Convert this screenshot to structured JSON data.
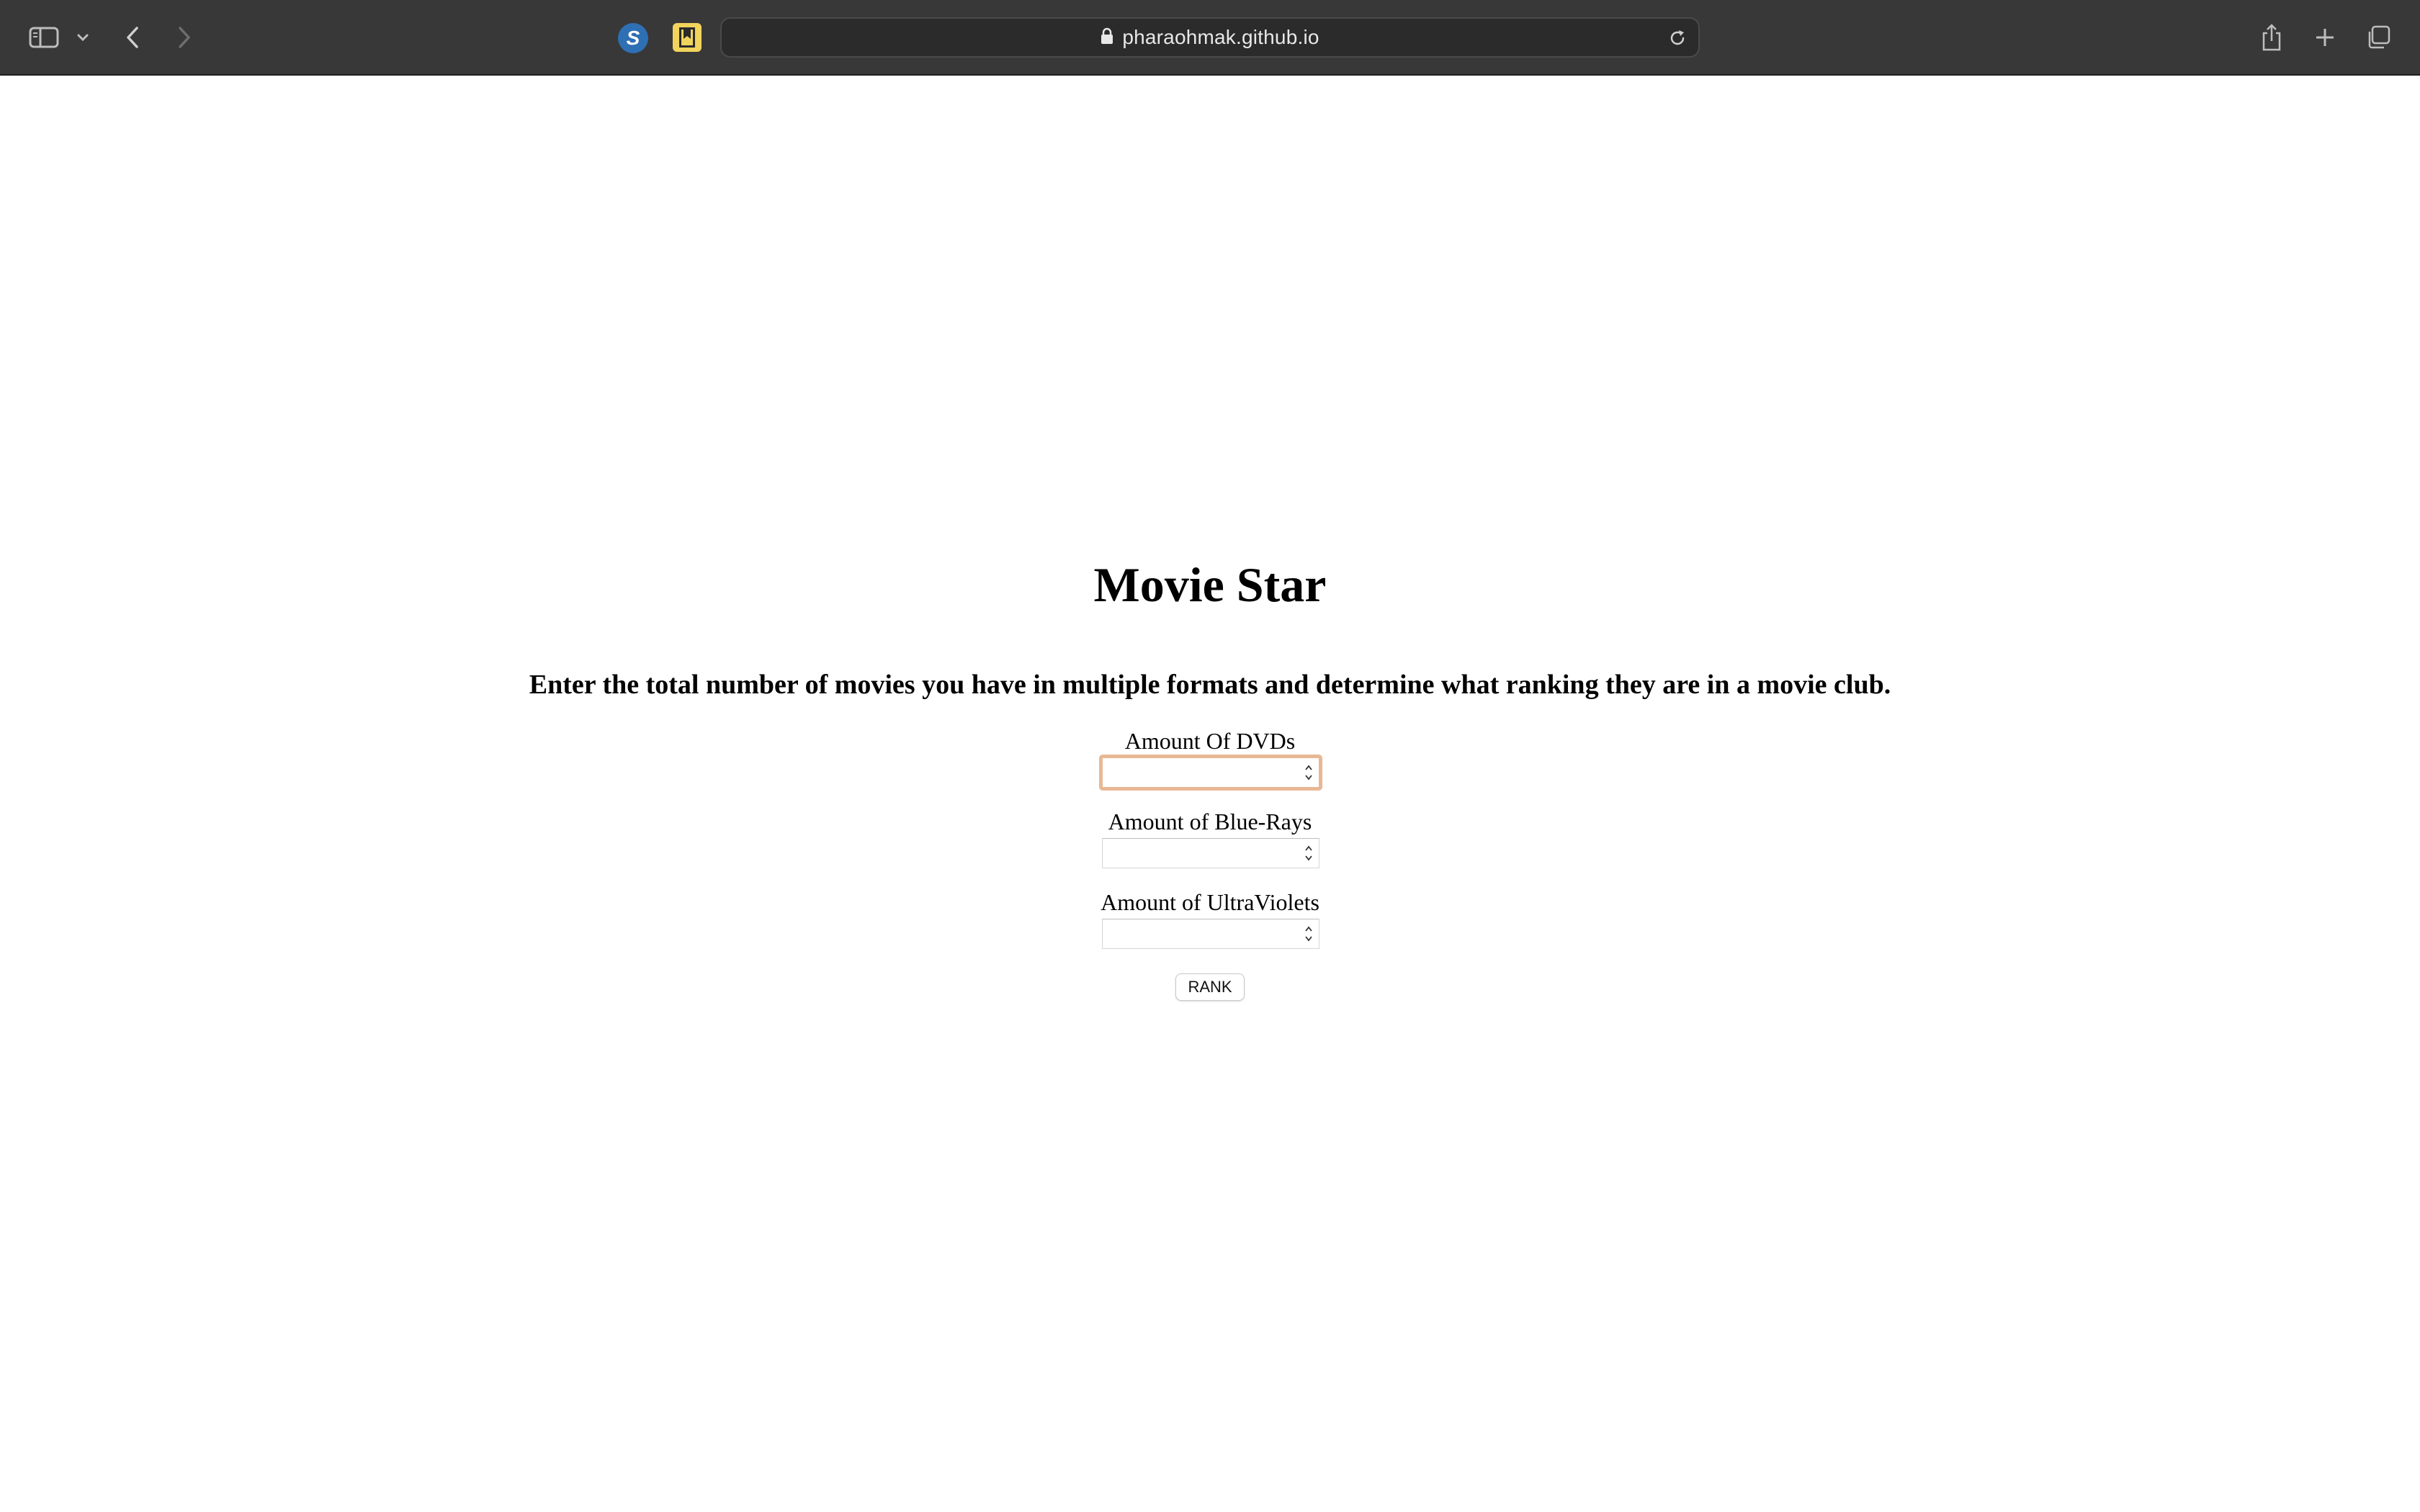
{
  "browser": {
    "url": "pharaohmak.github.io",
    "extension_s_letter": "S",
    "icons": {
      "sidebar": "sidebar-icon",
      "tab_group_menu": "chevron-down-icon",
      "back": "back-arrow-icon",
      "forward": "forward-arrow-icon",
      "lock": "lock-icon",
      "reload": "reload-icon",
      "share": "share-icon",
      "new_tab": "plus-icon",
      "tab_overview": "tabs-overview-icon"
    }
  },
  "page": {
    "title": "Movie Star",
    "subtitle": "Enter the total number of movies you have in multiple formats and determine what ranking they are in a movie club.",
    "fields": [
      {
        "label": "Amount Of DVDs",
        "value": ""
      },
      {
        "label": "Amount of Blue-Rays",
        "value": ""
      },
      {
        "label": "Amount of UltraViolets",
        "value": ""
      }
    ],
    "button_label": "RANK"
  },
  "colors": {
    "toolbar_bg": "#383838",
    "focus_ring": "#e8b894",
    "extension_s_bg": "#2f6fb3",
    "bookmark_ext_bg": "#f2d45c"
  }
}
